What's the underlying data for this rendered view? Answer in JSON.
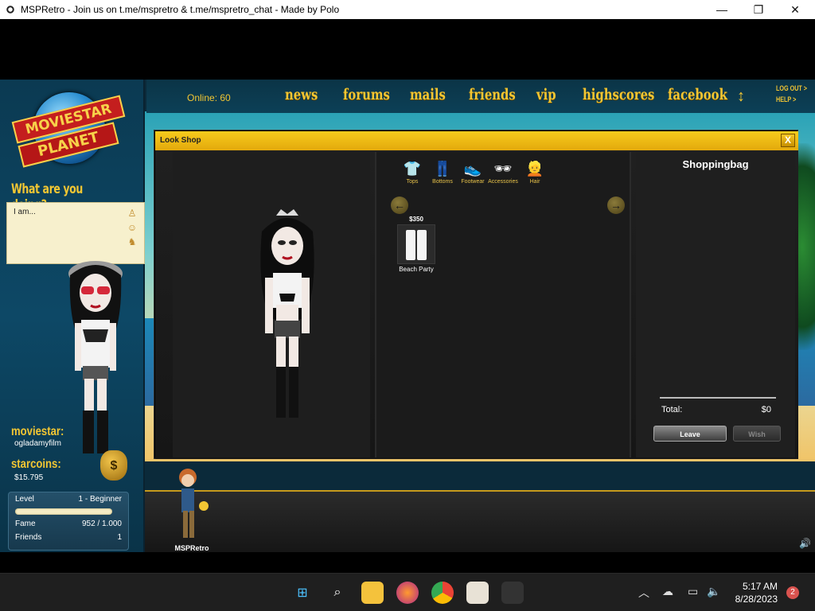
{
  "window": {
    "title": "MSPRetro - Join us on t.me/mspretro & t.me/mspretro_chat - Made by Polo",
    "minimize": "—",
    "maximize": "❐",
    "close": "✕"
  },
  "logo": {
    "line1": "MOVIESTAR",
    "line2": "PLANET"
  },
  "status": {
    "heading": "What are you doing?",
    "text": "I am..."
  },
  "nav": {
    "online": "Online: 60",
    "links": [
      "news",
      "forums",
      "mails",
      "friends",
      "vip",
      "highscores",
      "facebook"
    ],
    "updown": "↕",
    "logout": "LOG OUT >",
    "help": "HELP >"
  },
  "profile": {
    "moviestar_label": "moviestar:",
    "moviestar_name": "ogladamyfilm",
    "starcoins_label": "starcoins:",
    "starcoins_value": "$15.795",
    "money_symbol": "$",
    "level_label": "Level",
    "level_value": "1 - Beginner",
    "level_progress": 1.0,
    "fame_label": "Fame",
    "fame_value": "952 / 1.000",
    "friends_label": "Friends",
    "friends_value": "1"
  },
  "lookshop": {
    "title": "Look Shop",
    "close": "X",
    "categories": [
      "Tops",
      "Bottoms",
      "Footwear",
      "Accessories",
      "Hair"
    ],
    "category_icons": [
      "shirt-icon",
      "pants-icon",
      "shoes-icon",
      "sunglasses-icon",
      "hair-icon"
    ],
    "prev": "←",
    "next": "→",
    "item": {
      "price": "$350",
      "name": "Beach Party"
    },
    "bag_title": "Shoppingbag",
    "total_label": "Total:",
    "total_value": "$0",
    "leave": "Leave",
    "wish": "Wish"
  },
  "chat": {
    "name": "MSPRetro"
  },
  "taskbar": {
    "time": "5:17 AM",
    "date": "8/28/2023",
    "notifications": "2"
  },
  "colors": {
    "accent_gold": "#f2c633",
    "shop_title": "#f7cb1c",
    "panel_blue": "#0b3a52"
  }
}
